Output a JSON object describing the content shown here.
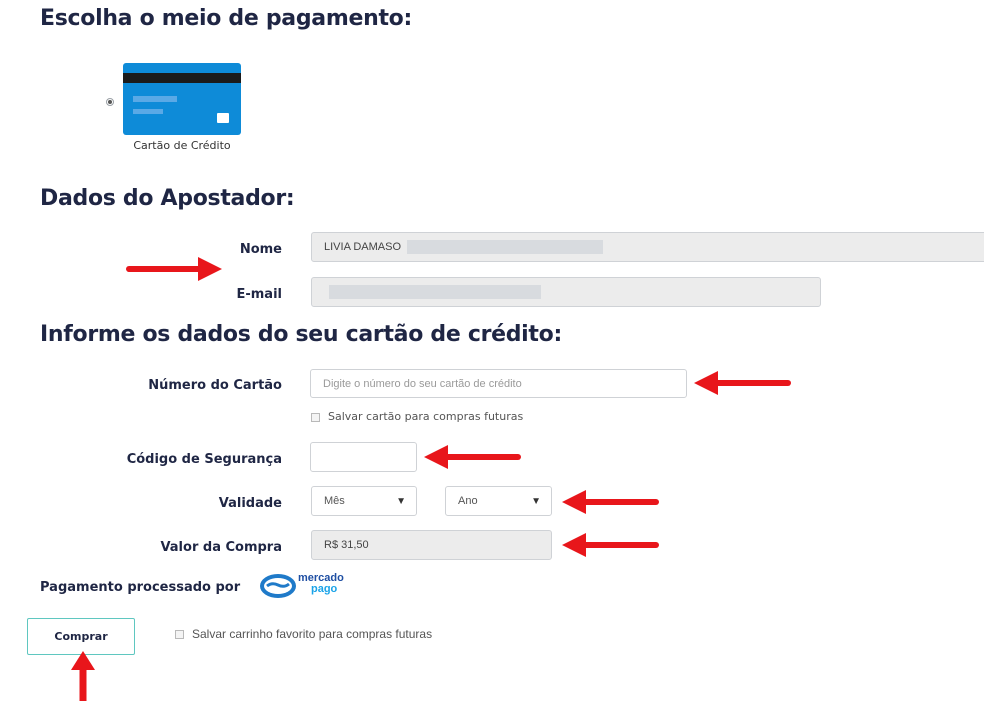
{
  "payment_section": {
    "title": "Escolha o meio de pagamento:",
    "option_label": "Cartão de Crédito",
    "card_icon": "credit-card-icon"
  },
  "bettor_section": {
    "title": "Dados do Apostador:",
    "name_label": "Nome",
    "name_value": "LIVIA DAMASO",
    "email_label": "E-mail",
    "email_value": ""
  },
  "card_section": {
    "title": "Informe os dados do seu cartão de crédito:",
    "card_number_label": "Número do Cartão",
    "card_number_placeholder": "Digite o número do seu cartão de crédito",
    "save_card_label": "Salvar cartão para compras futuras",
    "security_code_label": "Código de Segurança",
    "validity_label": "Validade",
    "month_value": "Mês",
    "year_value": "Ano",
    "purchase_value_label": "Valor da Compra",
    "purchase_value": "R$ 31,50"
  },
  "processor": {
    "label": "Pagamento processado por",
    "logo_line1": "mercado",
    "logo_line2": "pago"
  },
  "actions": {
    "buy_label": "Comprar",
    "save_cart_label": "Salvar carrinho favorito para compras futuras"
  },
  "colors": {
    "heading": "#1f2644",
    "card_blue": "#0e8bd8",
    "arrow_red": "#e8161b",
    "button_border": "#5fc7c0"
  }
}
